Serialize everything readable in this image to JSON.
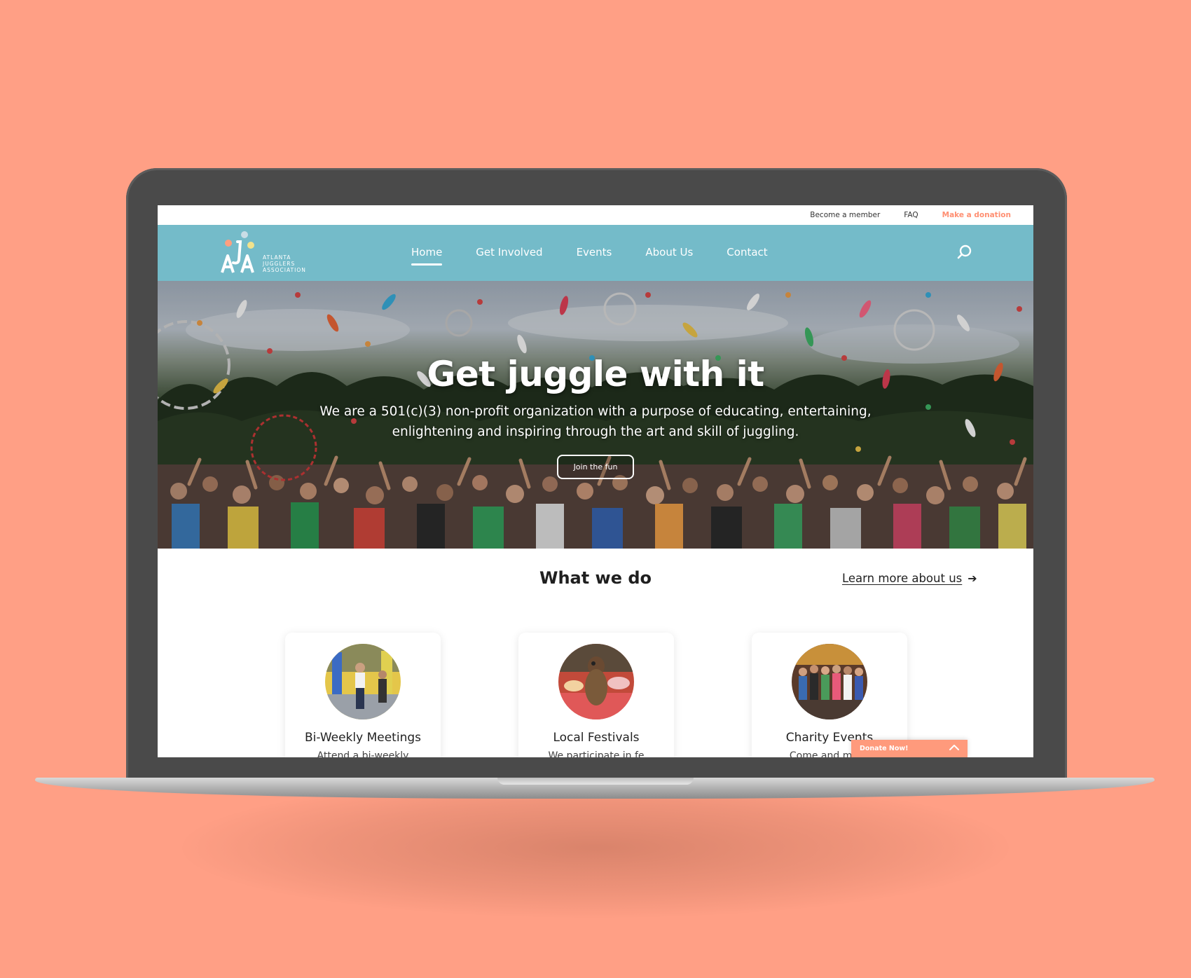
{
  "colors": {
    "background": "#ff9f85",
    "nav": "#74bbc9",
    "accent": "#ff8f72",
    "text": "#222222"
  },
  "utility_bar": {
    "items": [
      {
        "label": "Become a member"
      },
      {
        "label": "FAQ"
      },
      {
        "label": "Make a donation"
      }
    ]
  },
  "logo": {
    "lines": [
      "ATLANTA",
      "JUGGLERS",
      "ASSOCIATION"
    ]
  },
  "nav": {
    "items": [
      {
        "label": "Home",
        "active": true
      },
      {
        "label": "Get Involved"
      },
      {
        "label": "Events"
      },
      {
        "label": "About Us"
      },
      {
        "label": "Contact"
      }
    ],
    "search_icon": "search-icon"
  },
  "hero": {
    "title": "Get juggle with it",
    "subtitle": "We are a 501(c)(3) non-profit organization with a purpose of educating, entertaining, enlightening and inspiring through the art and skill of juggling.",
    "cta": "Join the fun"
  },
  "what_we_do": {
    "title": "What we do",
    "learn_more": "Learn more about us",
    "cards": [
      {
        "title": "Bi-Weekly Meetings",
        "desc": "Attend a bi-weekly"
      },
      {
        "title": "Local Festivals",
        "desc": "We participate in fe"
      },
      {
        "title": "Charity Events",
        "desc": "Come and make"
      }
    ]
  },
  "donate_tab": {
    "label": "Donate Now!"
  }
}
